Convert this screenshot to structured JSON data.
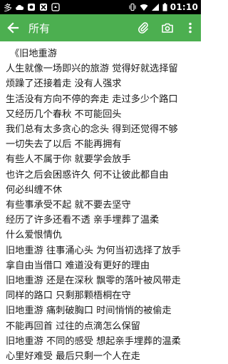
{
  "status_bar": {
    "time": "01:10",
    "left_icons": [
      "text-icon",
      "cloud-icon",
      "app-icon",
      "app-icon",
      "app-icon"
    ],
    "right_icons": [
      "vibrate-icon",
      "wifi-icon",
      "signal-icon",
      "battery-icon"
    ]
  },
  "app_bar": {
    "title": "所有",
    "color": "#4caf50"
  },
  "document": {
    "title_line": "《旧地重游",
    "lines": [
      "人生就像一场即兴的旅游 觉得好就选择留",
      "烦躁了还接着走 没有人强求",
      "生活没有方向不停的奔走 走过多少个路口",
      "又经历几个春秋 不可能回头",
      "我们总有太多贪心的念头 得到还觉得不够",
      "一切失去了以后 不能再拥有",
      "有些人不属于你 就要学会放手",
      "也许之后会困惑许久 何不让彼此都自由",
      "何必纠缠不休",
      "有些事承受不起 就不要去坚守",
      "经历了许多还看不透 亲手埋葬了温柔",
      "什么爱恨情仇",
      "旧地重游 往事涌心头 为何当初选择了放手",
      "拿自由当借口 难道没有更好的理由",
      "旧地重游 还是在深秋 飘零的落叶被风带走",
      "同样的路口 只剩那颗梧桐在守",
      "旧地重游 痛刺破胸口 时间悄悄的被偷走",
      "不能再回首 过往的点滴怎么保留",
      "旧地重游 不同的感受 想起亲手埋葬的温柔",
      "心里好难受 最后只剩一个人在走"
    ]
  }
}
